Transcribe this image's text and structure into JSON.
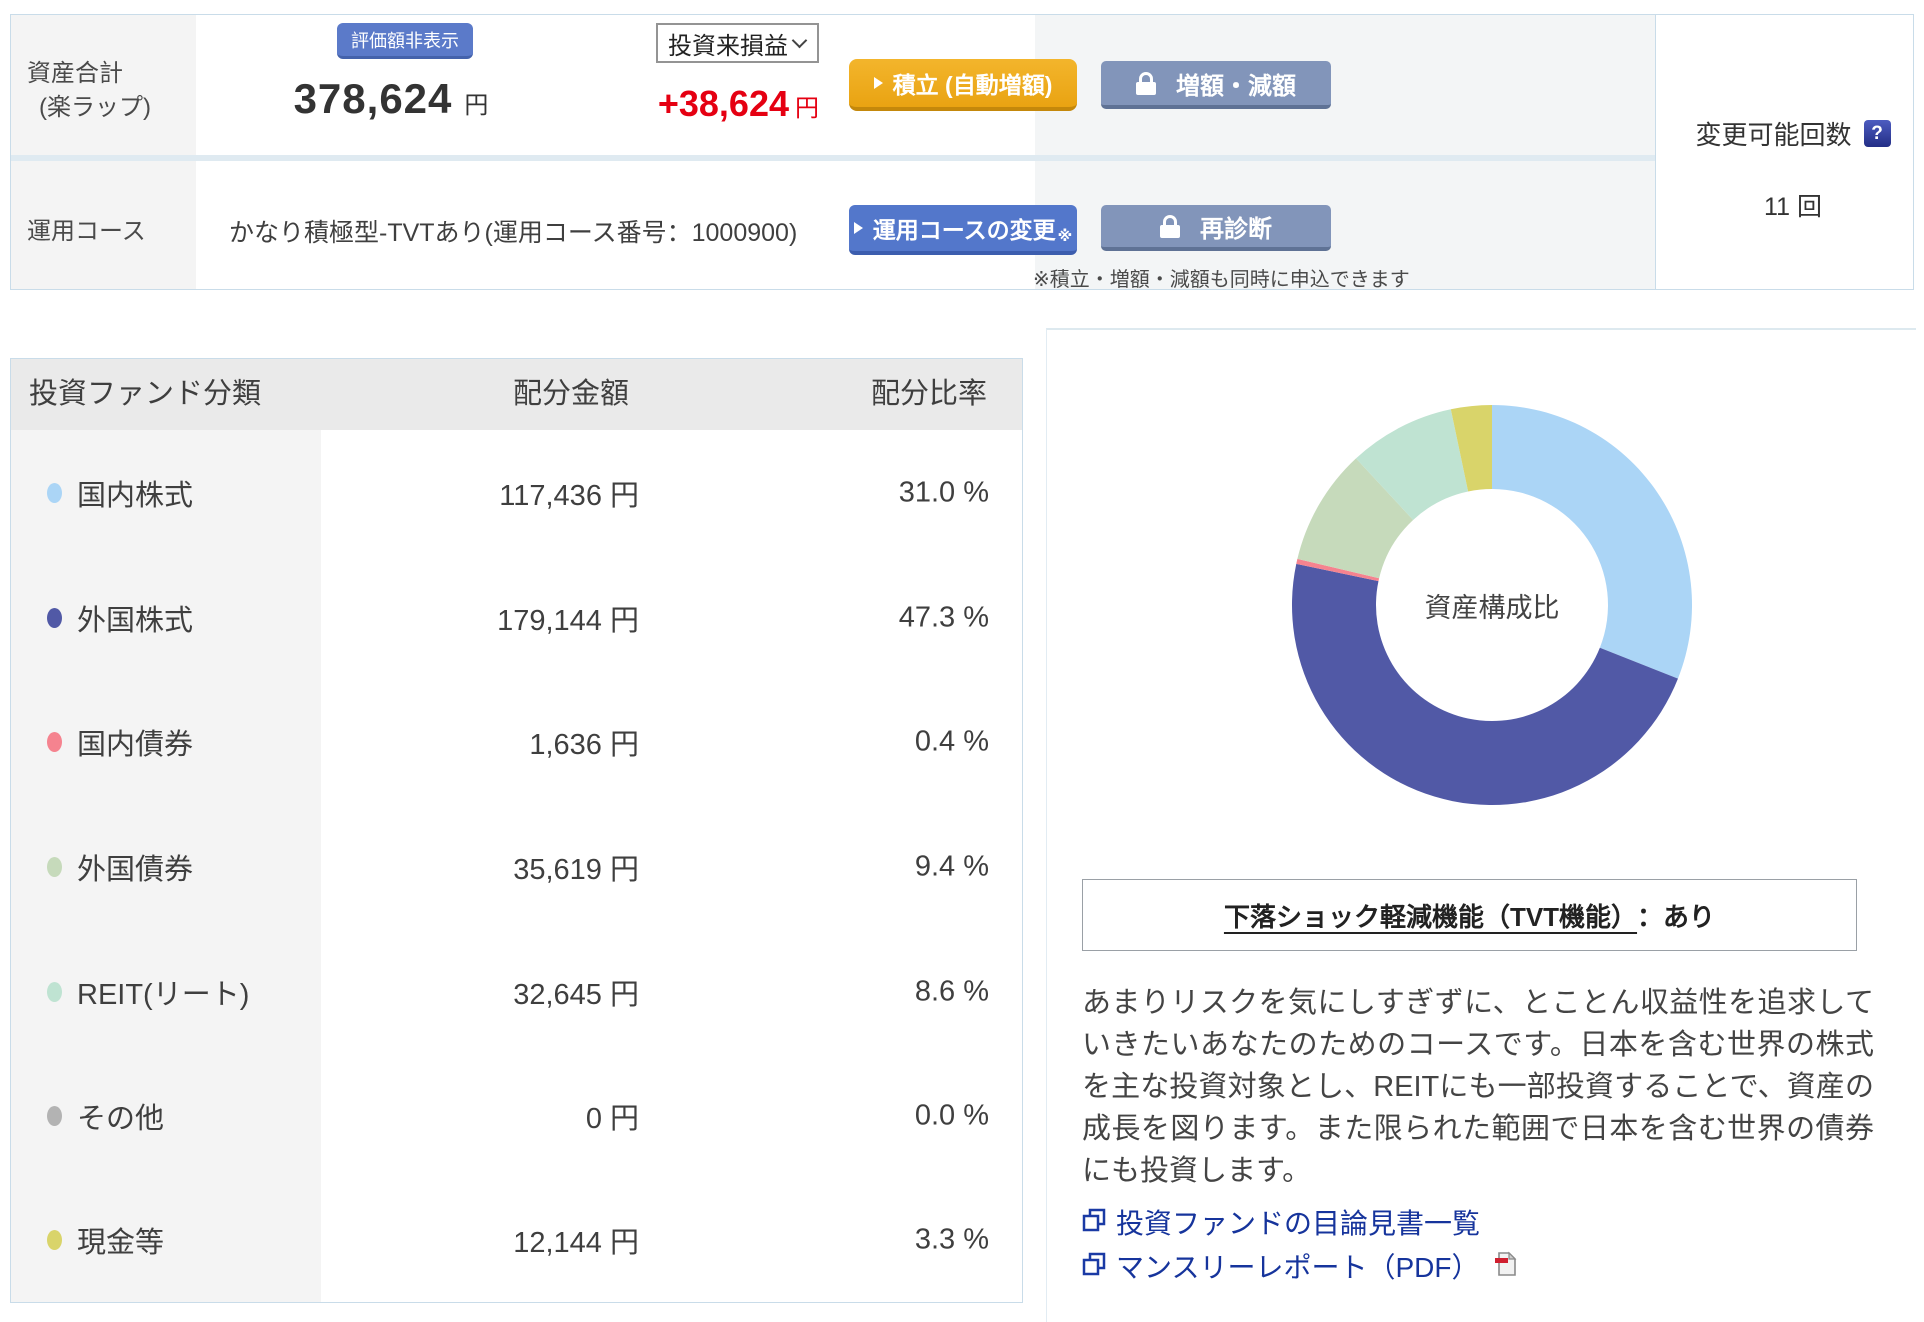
{
  "header": {
    "asset_total_label_line1": "資産合計",
    "asset_total_label_line2": "(楽ラップ)",
    "hide_value_button": "評価額非表示",
    "asset_total_value": "378,624",
    "asset_total_unit": "円",
    "pl_dropdown_value": "投資来損益",
    "pl_value": "+38,624",
    "pl_unit": "円",
    "tsumitate_button": "積立 (自動増額)",
    "zougaku_button": "増額・減額",
    "course_row_label": "運用コース",
    "course_name": "かなり積極型-TVTあり(運用コース番号：1000900)",
    "course_change_button": "運用コースの変更",
    "course_change_mark": "※",
    "rediagnosis_button": "再診断",
    "note": "※積立・増額・減額も同時に申込できます",
    "change_count_label": "変更可能回数",
    "change_count_value": "11 回"
  },
  "icons": {
    "help_icon": "?",
    "dropdown_chevron": "v-chevron",
    "action_arrow": "right-triangle",
    "lock": "padlock",
    "external_link": "overlapping-windows",
    "pdf": "pdf-document"
  },
  "table": {
    "headers": [
      "投資ファンド分類",
      "配分金額",
      "配分比率"
    ],
    "rows": [
      {
        "label": "国内株式",
        "amount": "117,436 円",
        "ratio": "31.0 %"
      },
      {
        "label": "外国株式",
        "amount": "179,144 円",
        "ratio": "47.3 %"
      },
      {
        "label": "国内債券",
        "amount": "1,636 円",
        "ratio": "0.4 %"
      },
      {
        "label": "外国債券",
        "amount": "35,619 円",
        "ratio": "9.4 %"
      },
      {
        "label": "REIT(リート)",
        "amount": "32,645 円",
        "ratio": "8.6 %"
      },
      {
        "label": "その他",
        "amount": "0 円",
        "ratio": "0.0 %"
      },
      {
        "label": "現金等",
        "amount": "12,144 円",
        "ratio": "3.3 %"
      }
    ]
  },
  "chart_data": {
    "type": "pie",
    "subtype": "donut",
    "center_label": "資産構成比",
    "unit": "%",
    "start_angle_deg": 0,
    "direction": "clockwise",
    "slices": [
      {
        "label": "国内株式",
        "value": 31.0,
        "color": "#abd5f6"
      },
      {
        "label": "外国株式",
        "value": 47.3,
        "color": "#5159a6"
      },
      {
        "label": "国内債券",
        "value": 0.4,
        "color": "#f5838f"
      },
      {
        "label": "外国債券",
        "value": 9.4,
        "color": "#c6dabb"
      },
      {
        "label": "REIT(リート)",
        "value": 8.6,
        "color": "#bfe3d2"
      },
      {
        "label": "その他",
        "value": 0.0,
        "color": "#b3b3b3"
      },
      {
        "label": "現金等",
        "value": 3.3,
        "color": "#d9d46a"
      }
    ]
  },
  "tvt": {
    "title_underlined": "下落ショック軽減機能（TVT機能）",
    "title_suffix": "：あり"
  },
  "description": "あまりリスクを気にしすぎずに、とことん収益性を追求していきたいあなたのためのコースです。日本を含む世界の株式を主な投資対象とし、REITにも一部投資することで、資産の成長を図ります。また限られた範囲で日本を含む世界の債券にも投資します。",
  "links": [
    {
      "label": "投資ファンドの目論見書一覧"
    },
    {
      "label": "マンスリーレポート（PDF）"
    }
  ]
}
